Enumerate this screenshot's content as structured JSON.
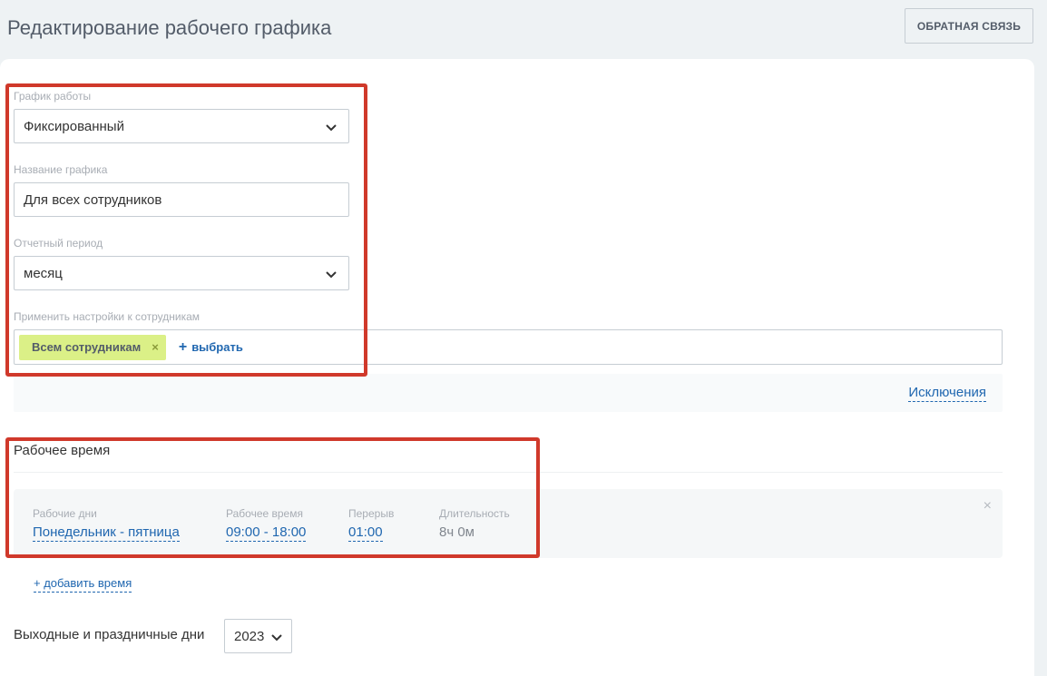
{
  "header": {
    "title": "Редактирование рабочего графика",
    "feedback_label": "ОБРАТНАЯ СВЯЗЬ"
  },
  "form": {
    "schedule_type": {
      "label": "График работы",
      "value": "Фиксированный"
    },
    "schedule_name": {
      "label": "Название графика",
      "value": "Для всех сотрудников"
    },
    "report_period": {
      "label": "Отчетный период",
      "value": "месяц"
    },
    "apply_to": {
      "label": "Применить настройки к сотрудникам",
      "tag": "Всем сотрудникам",
      "tag_remove": "×",
      "select_plus": "+",
      "select_label": "выбрать"
    },
    "exceptions_label": "Исключения"
  },
  "working_time": {
    "title": "Рабочее время",
    "row": {
      "days_label": "Рабочие дни",
      "days_value": "Понедельник - пятница",
      "hours_label": "Рабочее время",
      "hours_value": "09:00 - 18:00",
      "break_label": "Перерыв",
      "break_value": "01:00",
      "duration_label": "Длительность",
      "duration_value": "8ч 0м",
      "close": "×"
    },
    "add_time_label": "+ добавить время"
  },
  "holidays": {
    "label": "Выходные и праздничные дни",
    "year": "2023"
  },
  "colors": {
    "accent": "#2067b0",
    "tag_bg": "#dbf087",
    "highlight": "#d0392b"
  }
}
